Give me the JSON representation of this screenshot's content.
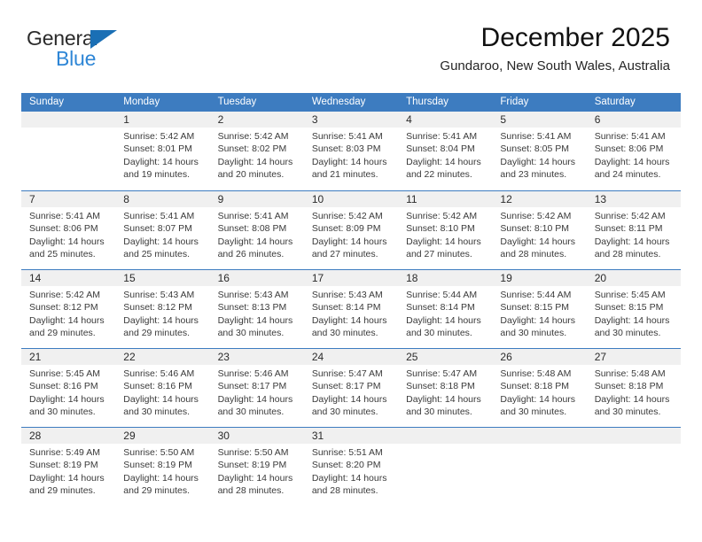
{
  "brand": {
    "word1": "General",
    "word2": "Blue",
    "triangle_color": "#1a6fb5",
    "word2_color": "#2e86d6"
  },
  "header": {
    "title": "December 2025",
    "subtitle": "Gundaroo, New South Wales, Australia"
  },
  "colors": {
    "header_blue": "#3d7cc0",
    "daynum_band": "#f0f0f0",
    "text": "#3a3a3a"
  },
  "weekdays": [
    "Sunday",
    "Monday",
    "Tuesday",
    "Wednesday",
    "Thursday",
    "Friday",
    "Saturday"
  ],
  "weeks": [
    [
      {
        "day": "",
        "empty": true,
        "sunrise": "",
        "sunset": "",
        "daylight1": "",
        "daylight2": ""
      },
      {
        "day": "1",
        "sunrise": "Sunrise: 5:42 AM",
        "sunset": "Sunset: 8:01 PM",
        "daylight1": "Daylight: 14 hours",
        "daylight2": "and 19 minutes."
      },
      {
        "day": "2",
        "sunrise": "Sunrise: 5:42 AM",
        "sunset": "Sunset: 8:02 PM",
        "daylight1": "Daylight: 14 hours",
        "daylight2": "and 20 minutes."
      },
      {
        "day": "3",
        "sunrise": "Sunrise: 5:41 AM",
        "sunset": "Sunset: 8:03 PM",
        "daylight1": "Daylight: 14 hours",
        "daylight2": "and 21 minutes."
      },
      {
        "day": "4",
        "sunrise": "Sunrise: 5:41 AM",
        "sunset": "Sunset: 8:04 PM",
        "daylight1": "Daylight: 14 hours",
        "daylight2": "and 22 minutes."
      },
      {
        "day": "5",
        "sunrise": "Sunrise: 5:41 AM",
        "sunset": "Sunset: 8:05 PM",
        "daylight1": "Daylight: 14 hours",
        "daylight2": "and 23 minutes."
      },
      {
        "day": "6",
        "sunrise": "Sunrise: 5:41 AM",
        "sunset": "Sunset: 8:06 PM",
        "daylight1": "Daylight: 14 hours",
        "daylight2": "and 24 minutes."
      }
    ],
    [
      {
        "day": "7",
        "sunrise": "Sunrise: 5:41 AM",
        "sunset": "Sunset: 8:06 PM",
        "daylight1": "Daylight: 14 hours",
        "daylight2": "and 25 minutes."
      },
      {
        "day": "8",
        "sunrise": "Sunrise: 5:41 AM",
        "sunset": "Sunset: 8:07 PM",
        "daylight1": "Daylight: 14 hours",
        "daylight2": "and 25 minutes."
      },
      {
        "day": "9",
        "sunrise": "Sunrise: 5:41 AM",
        "sunset": "Sunset: 8:08 PM",
        "daylight1": "Daylight: 14 hours",
        "daylight2": "and 26 minutes."
      },
      {
        "day": "10",
        "sunrise": "Sunrise: 5:42 AM",
        "sunset": "Sunset: 8:09 PM",
        "daylight1": "Daylight: 14 hours",
        "daylight2": "and 27 minutes."
      },
      {
        "day": "11",
        "sunrise": "Sunrise: 5:42 AM",
        "sunset": "Sunset: 8:10 PM",
        "daylight1": "Daylight: 14 hours",
        "daylight2": "and 27 minutes."
      },
      {
        "day": "12",
        "sunrise": "Sunrise: 5:42 AM",
        "sunset": "Sunset: 8:10 PM",
        "daylight1": "Daylight: 14 hours",
        "daylight2": "and 28 minutes."
      },
      {
        "day": "13",
        "sunrise": "Sunrise: 5:42 AM",
        "sunset": "Sunset: 8:11 PM",
        "daylight1": "Daylight: 14 hours",
        "daylight2": "and 28 minutes."
      }
    ],
    [
      {
        "day": "14",
        "sunrise": "Sunrise: 5:42 AM",
        "sunset": "Sunset: 8:12 PM",
        "daylight1": "Daylight: 14 hours",
        "daylight2": "and 29 minutes."
      },
      {
        "day": "15",
        "sunrise": "Sunrise: 5:43 AM",
        "sunset": "Sunset: 8:12 PM",
        "daylight1": "Daylight: 14 hours",
        "daylight2": "and 29 minutes."
      },
      {
        "day": "16",
        "sunrise": "Sunrise: 5:43 AM",
        "sunset": "Sunset: 8:13 PM",
        "daylight1": "Daylight: 14 hours",
        "daylight2": "and 30 minutes."
      },
      {
        "day": "17",
        "sunrise": "Sunrise: 5:43 AM",
        "sunset": "Sunset: 8:14 PM",
        "daylight1": "Daylight: 14 hours",
        "daylight2": "and 30 minutes."
      },
      {
        "day": "18",
        "sunrise": "Sunrise: 5:44 AM",
        "sunset": "Sunset: 8:14 PM",
        "daylight1": "Daylight: 14 hours",
        "daylight2": "and 30 minutes."
      },
      {
        "day": "19",
        "sunrise": "Sunrise: 5:44 AM",
        "sunset": "Sunset: 8:15 PM",
        "daylight1": "Daylight: 14 hours",
        "daylight2": "and 30 minutes."
      },
      {
        "day": "20",
        "sunrise": "Sunrise: 5:45 AM",
        "sunset": "Sunset: 8:15 PM",
        "daylight1": "Daylight: 14 hours",
        "daylight2": "and 30 minutes."
      }
    ],
    [
      {
        "day": "21",
        "sunrise": "Sunrise: 5:45 AM",
        "sunset": "Sunset: 8:16 PM",
        "daylight1": "Daylight: 14 hours",
        "daylight2": "and 30 minutes."
      },
      {
        "day": "22",
        "sunrise": "Sunrise: 5:46 AM",
        "sunset": "Sunset: 8:16 PM",
        "daylight1": "Daylight: 14 hours",
        "daylight2": "and 30 minutes."
      },
      {
        "day": "23",
        "sunrise": "Sunrise: 5:46 AM",
        "sunset": "Sunset: 8:17 PM",
        "daylight1": "Daylight: 14 hours",
        "daylight2": "and 30 minutes."
      },
      {
        "day": "24",
        "sunrise": "Sunrise: 5:47 AM",
        "sunset": "Sunset: 8:17 PM",
        "daylight1": "Daylight: 14 hours",
        "daylight2": "and 30 minutes."
      },
      {
        "day": "25",
        "sunrise": "Sunrise: 5:47 AM",
        "sunset": "Sunset: 8:18 PM",
        "daylight1": "Daylight: 14 hours",
        "daylight2": "and 30 minutes."
      },
      {
        "day": "26",
        "sunrise": "Sunrise: 5:48 AM",
        "sunset": "Sunset: 8:18 PM",
        "daylight1": "Daylight: 14 hours",
        "daylight2": "and 30 minutes."
      },
      {
        "day": "27",
        "sunrise": "Sunrise: 5:48 AM",
        "sunset": "Sunset: 8:18 PM",
        "daylight1": "Daylight: 14 hours",
        "daylight2": "and 30 minutes."
      }
    ],
    [
      {
        "day": "28",
        "sunrise": "Sunrise: 5:49 AM",
        "sunset": "Sunset: 8:19 PM",
        "daylight1": "Daylight: 14 hours",
        "daylight2": "and 29 minutes."
      },
      {
        "day": "29",
        "sunrise": "Sunrise: 5:50 AM",
        "sunset": "Sunset: 8:19 PM",
        "daylight1": "Daylight: 14 hours",
        "daylight2": "and 29 minutes."
      },
      {
        "day": "30",
        "sunrise": "Sunrise: 5:50 AM",
        "sunset": "Sunset: 8:19 PM",
        "daylight1": "Daylight: 14 hours",
        "daylight2": "and 28 minutes."
      },
      {
        "day": "31",
        "sunrise": "Sunrise: 5:51 AM",
        "sunset": "Sunset: 8:20 PM",
        "daylight1": "Daylight: 14 hours",
        "daylight2": "and 28 minutes."
      },
      {
        "day": "",
        "empty": true,
        "sunrise": "",
        "sunset": "",
        "daylight1": "",
        "daylight2": ""
      },
      {
        "day": "",
        "empty": true,
        "sunrise": "",
        "sunset": "",
        "daylight1": "",
        "daylight2": ""
      },
      {
        "day": "",
        "empty": true,
        "sunrise": "",
        "sunset": "",
        "daylight1": "",
        "daylight2": ""
      }
    ]
  ]
}
